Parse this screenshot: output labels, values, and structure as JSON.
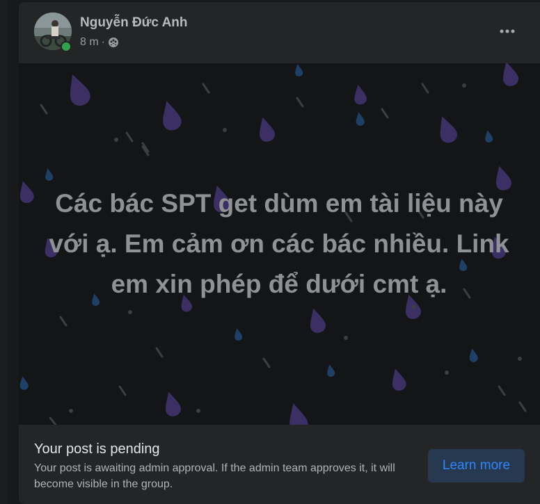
{
  "post": {
    "author": "Nguyễn Đức Anh",
    "time": "8 m",
    "separator": "·",
    "privacy_icon": "friends-group-icon",
    "more_icon": "more-dots-icon",
    "text": "Các bác SPT get dùm em tài liệu này với ạ. Em cảm ơn các bác nhiều. Link em xin phép để dưới cmt ạ.",
    "background": "rain-drops-pattern"
  },
  "pending": {
    "title": "Your post is pending",
    "description": "Your post is awaiting admin approval. If the admin team approves it, it will become visible in the group.",
    "button_label": "Learn more"
  },
  "colors": {
    "card": "#242526",
    "post_background": "#141517",
    "drop_purple": "#3b2f63",
    "drop_blue": "#1e3f66",
    "online": "#31a24c",
    "link_blue": "#2d88ff",
    "button_bg": "#263951"
  }
}
